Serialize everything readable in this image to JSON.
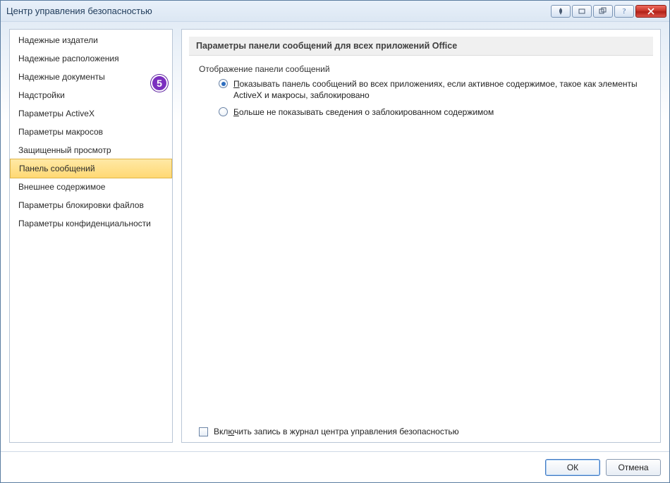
{
  "window": {
    "title": "Центр управления безопасностью",
    "callout_number": "5"
  },
  "sidebar": {
    "items": [
      {
        "label": "Надежные издатели"
      },
      {
        "label": "Надежные расположения"
      },
      {
        "label": "Надежные документы"
      },
      {
        "label": "Надстройки"
      },
      {
        "label": "Параметры ActiveX"
      },
      {
        "label": "Параметры макросов"
      },
      {
        "label": "Защищенный просмотр"
      },
      {
        "label": "Панель сообщений",
        "selected": true
      },
      {
        "label": "Внешнее содержимое"
      },
      {
        "label": "Параметры блокировки файлов"
      },
      {
        "label": "Параметры конфиденциальности"
      }
    ]
  },
  "main": {
    "section_title": "Параметры панели сообщений для всех приложений Office",
    "group_label": "Отображение панели сообщений",
    "radios": {
      "show_bar_hot": "П",
      "show_bar_rest": "оказывать панель сообщений во всех приложениях, если активное содержимое, такое как элементы ActiveX и макросы, заблокировано",
      "never_show_hot": "Б",
      "never_show_rest": "ольше не показывать сведения о заблокированном содержимом"
    },
    "logging": {
      "pre": "Вкл",
      "hot": "ю",
      "post": "чить запись в журнал центра управления безопасностью"
    }
  },
  "buttons": {
    "ok": "ОК",
    "cancel": "Отмена"
  }
}
